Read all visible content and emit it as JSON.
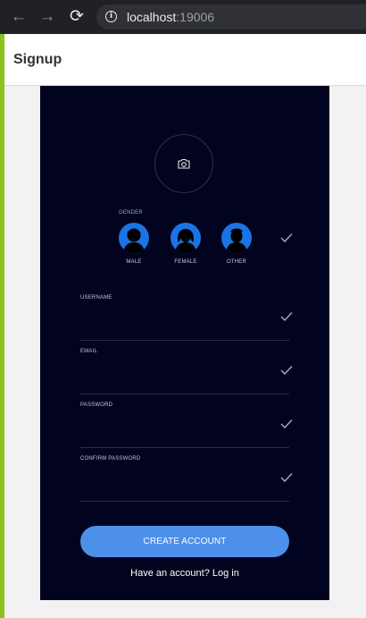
{
  "browser": {
    "url_host": "localhost",
    "url_port": ":19006",
    "back_glyph": "←",
    "forward_glyph": "→",
    "reload_glyph": "⟳",
    "info_glyph": "i"
  },
  "app": {
    "title": "Signup",
    "accent_color": "#8bc21c",
    "panel_color": "#02041f",
    "button_color": "#4d90ea"
  },
  "gender": {
    "label": "GENDER",
    "options": [
      {
        "label": "MALE",
        "icon": "male-avatar-icon"
      },
      {
        "label": "FEMALE",
        "icon": "female-avatar-icon"
      },
      {
        "label": "OTHER",
        "icon": "other-avatar-icon"
      }
    ]
  },
  "fields": {
    "username": {
      "label": "USERNAME",
      "value": ""
    },
    "email": {
      "label": "EMAIL",
      "value": ""
    },
    "password": {
      "label": "PASSWORD",
      "value": ""
    },
    "confirm_password": {
      "label": "CONFIRM PASSWORD",
      "value": ""
    }
  },
  "actions": {
    "create_account": "CREATE ACCOUNT",
    "login_prompt": "Have an account?",
    "login_link": "Log in"
  },
  "icons": [
    "back-arrow-icon",
    "forward-arrow-icon",
    "reload-icon",
    "info-icon",
    "camera-icon",
    "check-icon"
  ]
}
